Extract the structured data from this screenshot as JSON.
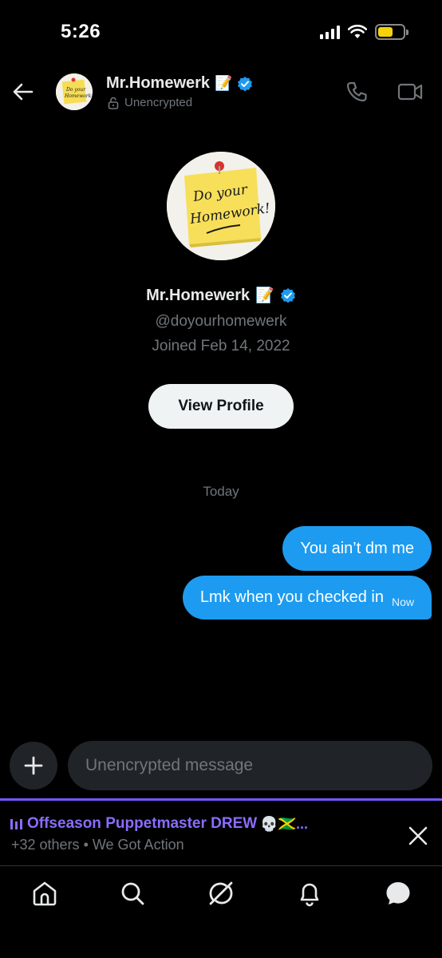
{
  "status_bar": {
    "time": "5:26"
  },
  "header": {
    "name": "Mr.Homewerk",
    "emoji": "📝",
    "encryption_status": "Unencrypted"
  },
  "avatar_art": {
    "line1": "Do your",
    "line2": "Homework!"
  },
  "profile": {
    "name": "Mr.Homewerk",
    "emoji": "📝",
    "handle": "@doyourhomewerk",
    "joined": "Joined Feb 14, 2022",
    "view_profile_label": "View Profile"
  },
  "conversation": {
    "day_label": "Today",
    "messages": [
      {
        "text": "You ain’t dm me"
      },
      {
        "text": "Lmk when you checked in",
        "time": "Now"
      }
    ]
  },
  "composer": {
    "placeholder": "Unencrypted message"
  },
  "spaces": {
    "title": "Offseason Puppetmaster DREW",
    "emoji": "💀🇯🇲...",
    "subtitle": "+32 others • We Got Action"
  },
  "colors": {
    "accent": "#1d9bf0",
    "spaces_purple": "#7856ff",
    "background": "#000000",
    "muted_text": "#71767b",
    "verified": "#1d9bf0"
  },
  "icons": {
    "back": "arrow-left-icon",
    "call": "phone-icon",
    "video": "video-camera-icon",
    "lock": "lock-open-icon",
    "verified": "verified-badge-icon",
    "plus": "plus-icon",
    "close": "close-icon",
    "tabs": [
      "home-icon",
      "search-icon",
      "grok-icon",
      "bell-icon",
      "messages-icon"
    ]
  }
}
